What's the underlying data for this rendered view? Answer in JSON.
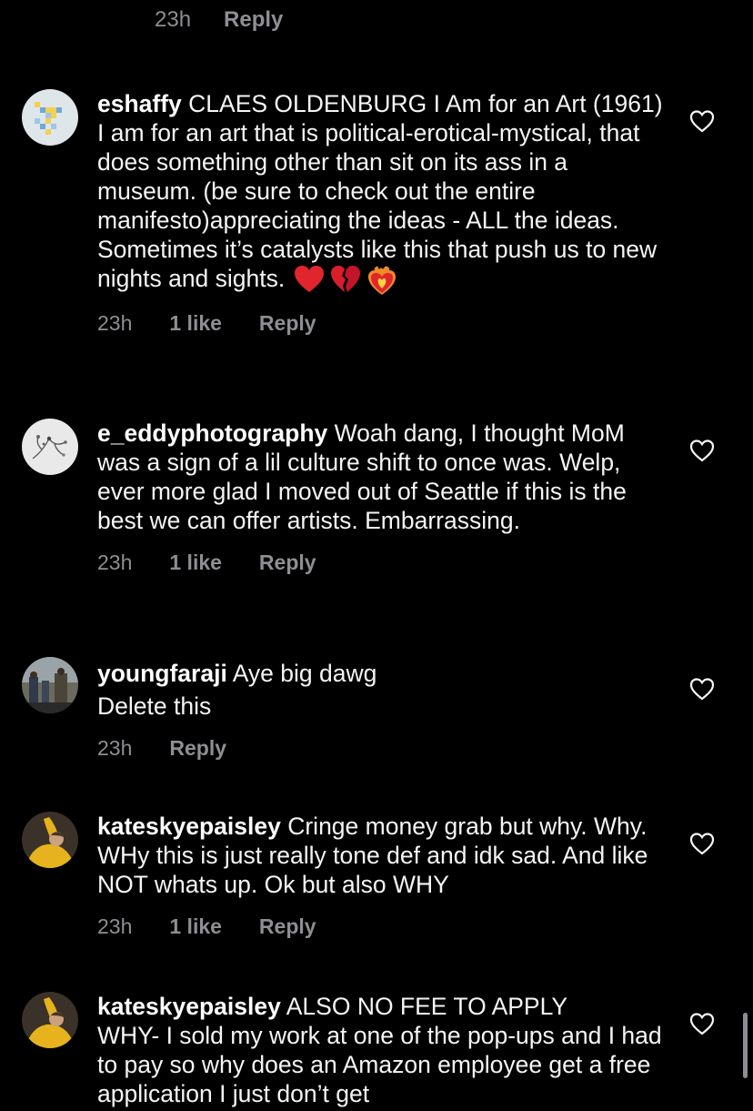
{
  "top_meta": {
    "time": "23h",
    "reply": "Reply"
  },
  "comments": [
    {
      "username": "eshaffy",
      "text": " CLAES OLDENBURG I Am for an Art (1961)\nI am for an art that is political-erotical-mystical, that does something other than sit on its ass in a museum. (be sure to check out the entire manifesto)appreciating the ideas - ALL the ideas. Sometimes it’s catalysts like this that push us to new nights and sights.",
      "emojis": [
        "red-heart",
        "broken-heart",
        "heart-on-fire"
      ],
      "time": "23h",
      "likes": "1 like",
      "reply": "Reply"
    },
    {
      "username": "e_eddyphotography",
      "text": " Woah dang, I thought MoM was a sign of a lil culture shift to once was. Welp, ever more glad I moved out of Seattle if this is the best we can offer artists. Embarrassing.",
      "time": "23h",
      "likes": "1 like",
      "reply": "Reply"
    },
    {
      "username": "youngfaraji",
      "text": " Aye big dawg\nDelete this",
      "time": "23h",
      "likes": "",
      "reply": "Reply"
    },
    {
      "username": "kateskyepaisley",
      "text": " Cringe money grab but why. Why. WHy this is just really tone def and idk sad. And like NOT whats up. Ok but also WHY",
      "time": "23h",
      "likes": "1 like",
      "reply": "Reply"
    },
    {
      "username": "kateskyepaisley",
      "text": " ALSO NO FEE TO APPLY\nWHY- I sold my work at one of the pop-ups and I had to pay so why does an Amazon employee get a free application I just don’t get",
      "time": "",
      "likes": "",
      "reply": ""
    }
  ]
}
